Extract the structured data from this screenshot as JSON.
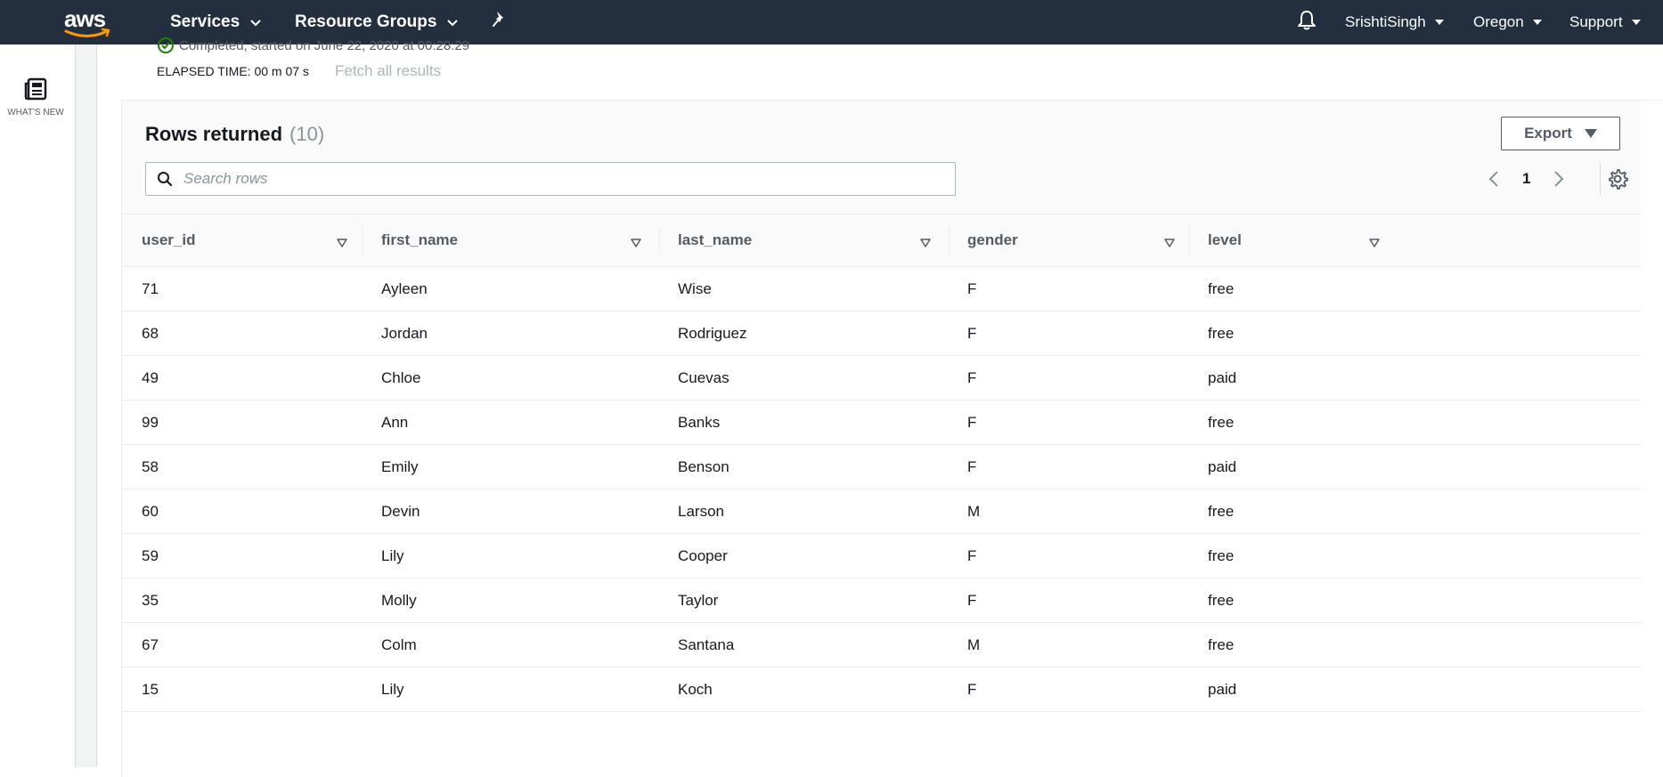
{
  "nav": {
    "logo_text": "aws",
    "services_label": "Services",
    "resource_groups_label": "Resource Groups",
    "account_label": "SrishtiSingh",
    "region_label": "Oregon",
    "support_label": "Support"
  },
  "leftrail": {
    "whats_new_label": "WHAT'S NEW"
  },
  "query_status": {
    "status_text": "Completed, started on June 22, 2020 at 00:28:29",
    "elapsed_text": "ELAPSED TIME: 00 m 07 s",
    "fetch_link_label": "Fetch all results"
  },
  "results": {
    "title": "Rows returned",
    "count": "(10)",
    "export_label": "Export",
    "search_placeholder": "Search rows",
    "page_number": "1",
    "columns": [
      "user_id",
      "first_name",
      "last_name",
      "gender",
      "level"
    ],
    "rows": [
      [
        "71",
        "Ayleen",
        "Wise",
        "F",
        "free"
      ],
      [
        "68",
        "Jordan",
        "Rodriguez",
        "F",
        "free"
      ],
      [
        "49",
        "Chloe",
        "Cuevas",
        "F",
        "paid"
      ],
      [
        "99",
        "Ann",
        "Banks",
        "F",
        "free"
      ],
      [
        "58",
        "Emily",
        "Benson",
        "F",
        "paid"
      ],
      [
        "60",
        "Devin",
        "Larson",
        "M",
        "free"
      ],
      [
        "59",
        "Lily",
        "Cooper",
        "F",
        "free"
      ],
      [
        "35",
        "Molly",
        "Taylor",
        "F",
        "free"
      ],
      [
        "67",
        "Colm",
        "Santana",
        "M",
        "free"
      ],
      [
        "15",
        "Lily",
        "Koch",
        "F",
        "paid"
      ]
    ]
  },
  "colors": {
    "nav_bg": "#232f3e",
    "success": "#1d8102",
    "text_primary": "#16191f",
    "text_secondary": "#545b64"
  }
}
